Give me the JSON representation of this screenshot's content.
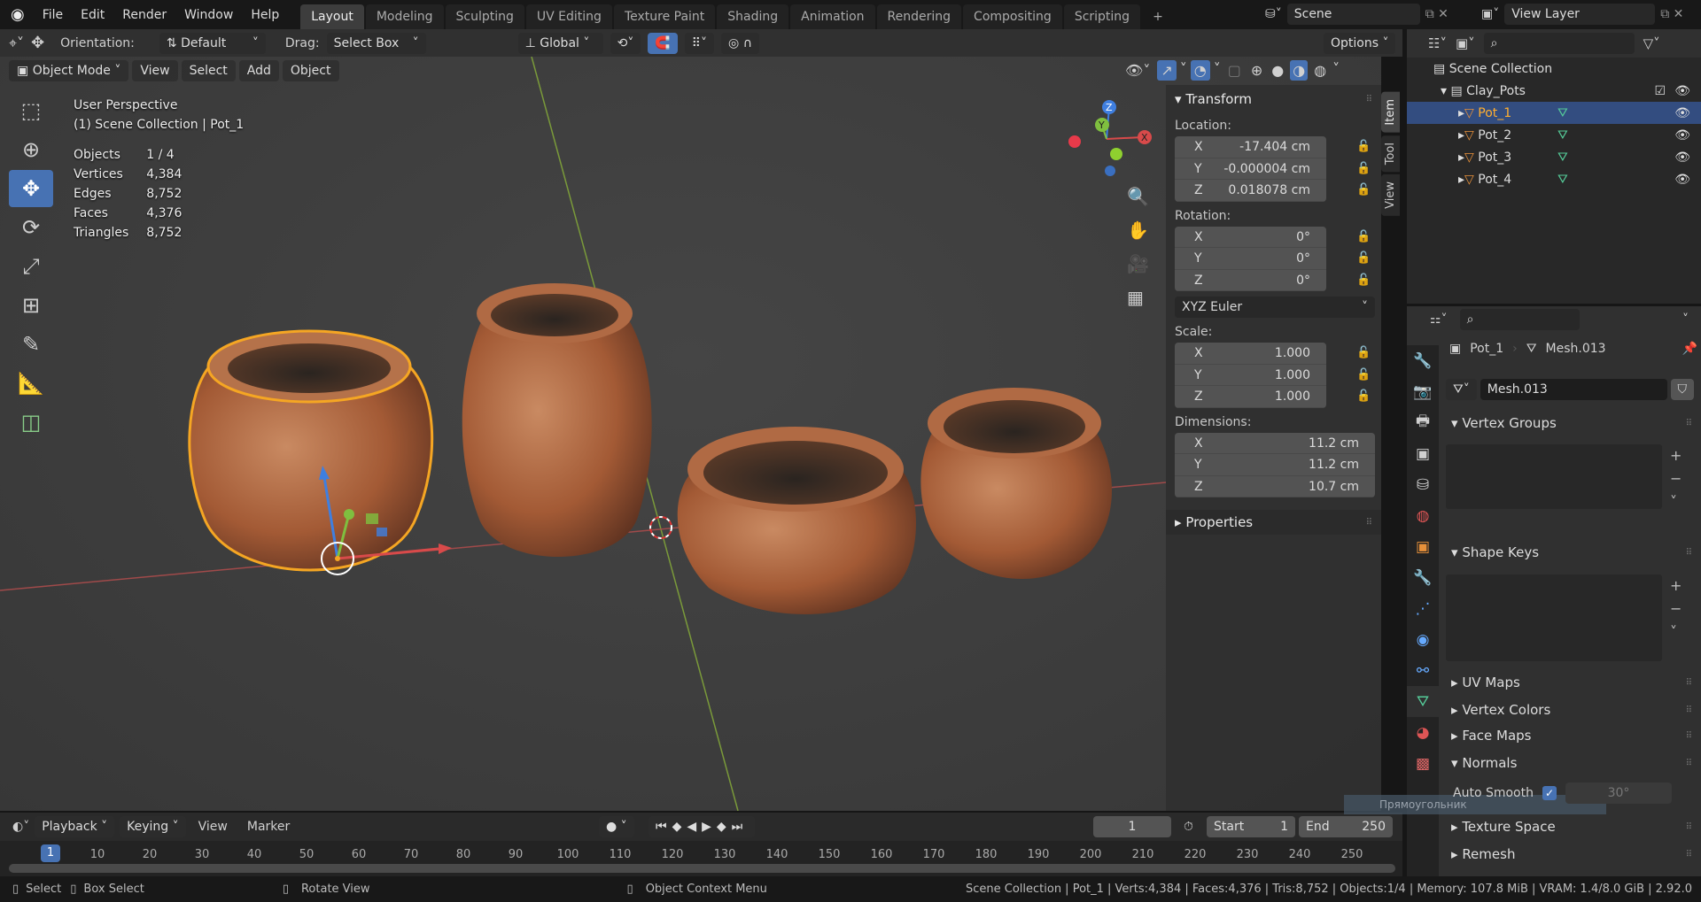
{
  "topbar": {
    "menus": [
      "File",
      "Edit",
      "Render",
      "Window",
      "Help"
    ],
    "workspaces": [
      "Layout",
      "Modeling",
      "Sculpting",
      "UV Editing",
      "Texture Paint",
      "Shading",
      "Animation",
      "Rendering",
      "Compositing",
      "Scripting"
    ],
    "active_workspace": "Layout",
    "add_tab": "+",
    "scene": "Scene",
    "view_layer": "View Layer"
  },
  "tool_settings": {
    "orientation_label": "Orientation:",
    "orientation_value": "Default",
    "drag_label": "Drag:",
    "drag_value": "Select Box",
    "transform_orientation": "Global",
    "options": "Options"
  },
  "viewport_header": {
    "mode": "Object Mode",
    "menus": [
      "View",
      "Select",
      "Add",
      "Object"
    ]
  },
  "viewport": {
    "perspective": "User Perspective",
    "collection_info": "(1) Scene Collection | Pot_1",
    "stats": [
      {
        "label": "Objects",
        "value": "1 / 4"
      },
      {
        "label": "Vertices",
        "value": "4,384"
      },
      {
        "label": "Edges",
        "value": "8,752"
      },
      {
        "label": "Faces",
        "value": "4,376"
      },
      {
        "label": "Triangles",
        "value": "8,752"
      }
    ],
    "gizmo_axes": [
      "X",
      "Y",
      "Z"
    ],
    "tooltip": "Прямоугольник",
    "colors": {
      "selection_outline": "#f5a623",
      "x_axis": "#d84a4a",
      "y_axis": "#7fbf3f",
      "z_axis": "#3f7fe0",
      "pot": "#a8603a"
    }
  },
  "npanel": {
    "tabs": [
      "Item",
      "Tool",
      "View"
    ],
    "active_tab": "Item",
    "transform_title": "Transform",
    "location_label": "Location:",
    "location": [
      {
        "axis": "X",
        "value": "-17.404 cm"
      },
      {
        "axis": "Y",
        "value": "-0.000004 cm"
      },
      {
        "axis": "Z",
        "value": "0.018078 cm"
      }
    ],
    "rotation_label": "Rotation:",
    "rotation": [
      {
        "axis": "X",
        "value": "0°"
      },
      {
        "axis": "Y",
        "value": "0°"
      },
      {
        "axis": "Z",
        "value": "0°"
      }
    ],
    "rotation_mode": "XYZ Euler",
    "scale_label": "Scale:",
    "scale": [
      {
        "axis": "X",
        "value": "1.000"
      },
      {
        "axis": "Y",
        "value": "1.000"
      },
      {
        "axis": "Z",
        "value": "1.000"
      }
    ],
    "dimensions_label": "Dimensions:",
    "dimensions": [
      {
        "axis": "X",
        "value": "11.2 cm"
      },
      {
        "axis": "Y",
        "value": "11.2 cm"
      },
      {
        "axis": "Z",
        "value": "10.7 cm"
      }
    ],
    "properties_title": "Properties"
  },
  "outliner": {
    "root": "Scene Collection",
    "collection": "Clay_Pots",
    "objects": [
      "Pot_1",
      "Pot_2",
      "Pot_3",
      "Pot_4"
    ],
    "selected": "Pot_1"
  },
  "properties": {
    "object": "Pot_1",
    "mesh": "Mesh.013",
    "datablock": "Mesh.013",
    "sections": {
      "vertex_groups": "Vertex Groups",
      "shape_keys": "Shape Keys",
      "uv_maps": "UV Maps",
      "vertex_colors": "Vertex Colors",
      "face_maps": "Face Maps",
      "normals": "Normals",
      "texture_space": "Texture Space",
      "remesh": "Remesh"
    },
    "auto_smooth_label": "Auto Smooth",
    "auto_smooth_checked": true,
    "auto_smooth_angle": "30°"
  },
  "timeline": {
    "menus": [
      "Playback",
      "Keying",
      "View",
      "Marker"
    ],
    "current_frame": "1",
    "start_label": "Start",
    "start": "1",
    "end_label": "End",
    "end": "250",
    "frame_labels": [
      "10",
      "20",
      "30",
      "40",
      "50",
      "60",
      "70",
      "80",
      "90",
      "100",
      "110",
      "120",
      "130",
      "140",
      "150",
      "160",
      "170",
      "180",
      "190",
      "200",
      "210",
      "220",
      "230",
      "240",
      "250"
    ]
  },
  "status": {
    "select": "Select",
    "box_select": "Box Select",
    "rotate_view": "Rotate View",
    "context_menu": "Object Context Menu",
    "info": "Scene Collection | Pot_1 | Verts:4,384 | Faces:4,376 | Tris:8,752 | Objects:1/4 | Memory: 107.8 MiB | VRAM: 1.4/8.0 GiB | 2.92.0"
  }
}
